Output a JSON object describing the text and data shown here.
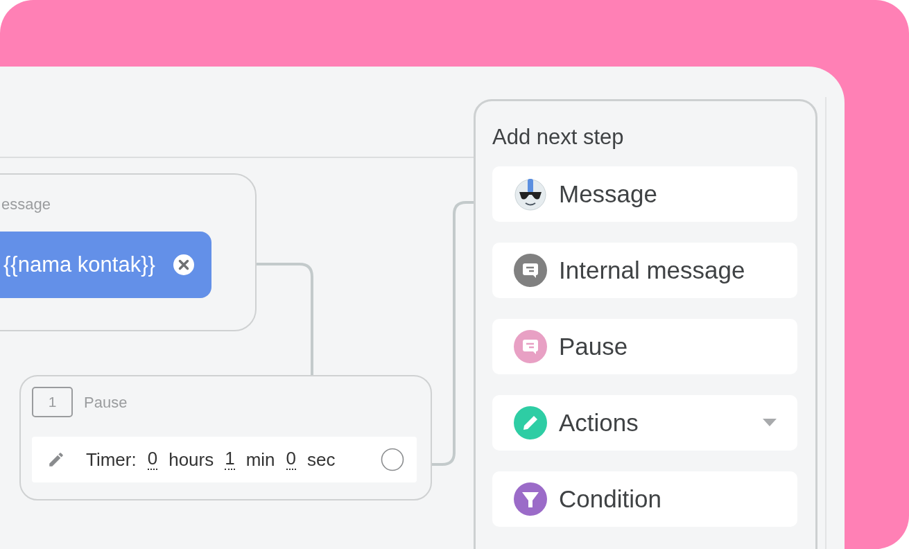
{
  "message_node": {
    "label": "essage",
    "tag": {
      "text": "{{nama kontak}}"
    }
  },
  "pause_node": {
    "number": "1",
    "title": "Pause",
    "timer": {
      "label": "Timer:",
      "hours": "0",
      "hours_unit": "hours",
      "minutes": "1",
      "minutes_unit": "min",
      "seconds": "0",
      "seconds_unit": "sec"
    }
  },
  "next_step_panel": {
    "title": "Add next step",
    "items": [
      {
        "label": "Message",
        "kind": "bot",
        "dropdown": false
      },
      {
        "label": "Internal message",
        "kind": "note",
        "color": "#808080",
        "dropdown": false
      },
      {
        "label": "Pause",
        "kind": "note",
        "color": "#e8a0c4",
        "dropdown": false
      },
      {
        "label": "Actions",
        "kind": "pencil",
        "color": "#2ecda4",
        "dropdown": true
      },
      {
        "label": "Condition",
        "kind": "filter",
        "color": "#9b6bc8",
        "dropdown": false
      }
    ]
  }
}
